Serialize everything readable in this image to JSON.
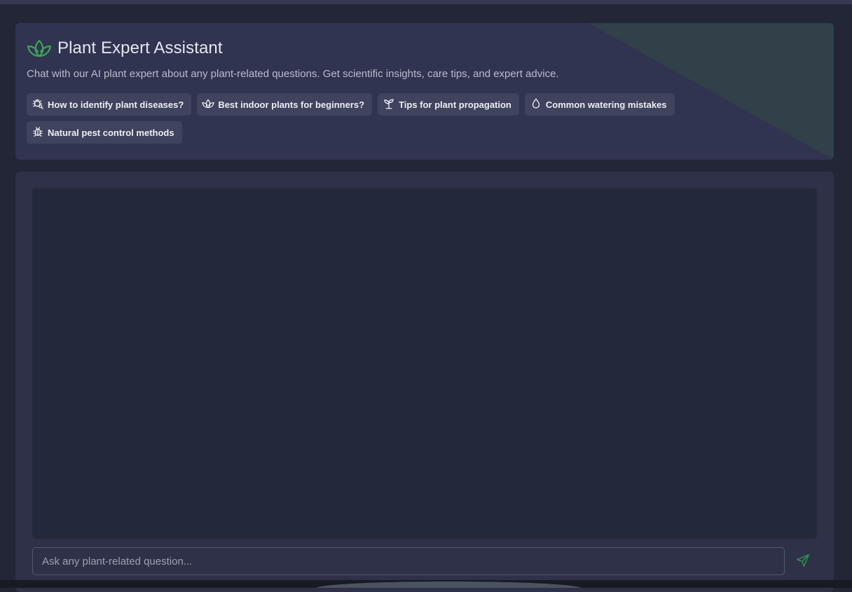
{
  "header": {
    "title": "Plant Expert Assistant",
    "subtitle": "Chat with our AI plant expert about any plant-related questions. Get scientific insights, care tips, and expert advice.",
    "logo_icon": "plant-leaves-icon",
    "logo_color": "#3aa655"
  },
  "suggestions": [
    {
      "icon": "bug-search-icon",
      "label": "How to identify plant diseases?"
    },
    {
      "icon": "plant-leaves-icon",
      "label": "Best indoor plants for beginners?"
    },
    {
      "icon": "sprout-icon",
      "label": "Tips for plant propagation"
    },
    {
      "icon": "droplet-icon",
      "label": "Common watering mistakes"
    },
    {
      "icon": "bug-icon",
      "label": "Natural pest control methods"
    }
  ],
  "chat": {
    "input_placeholder": "Ask any plant-related question...",
    "input_value": "",
    "send_icon": "send-icon",
    "send_color": "#2f8a4a"
  },
  "colors": {
    "background": "#222637",
    "card": "#313450",
    "chat_area": "#24283b",
    "accent_green": "#3aa655"
  }
}
